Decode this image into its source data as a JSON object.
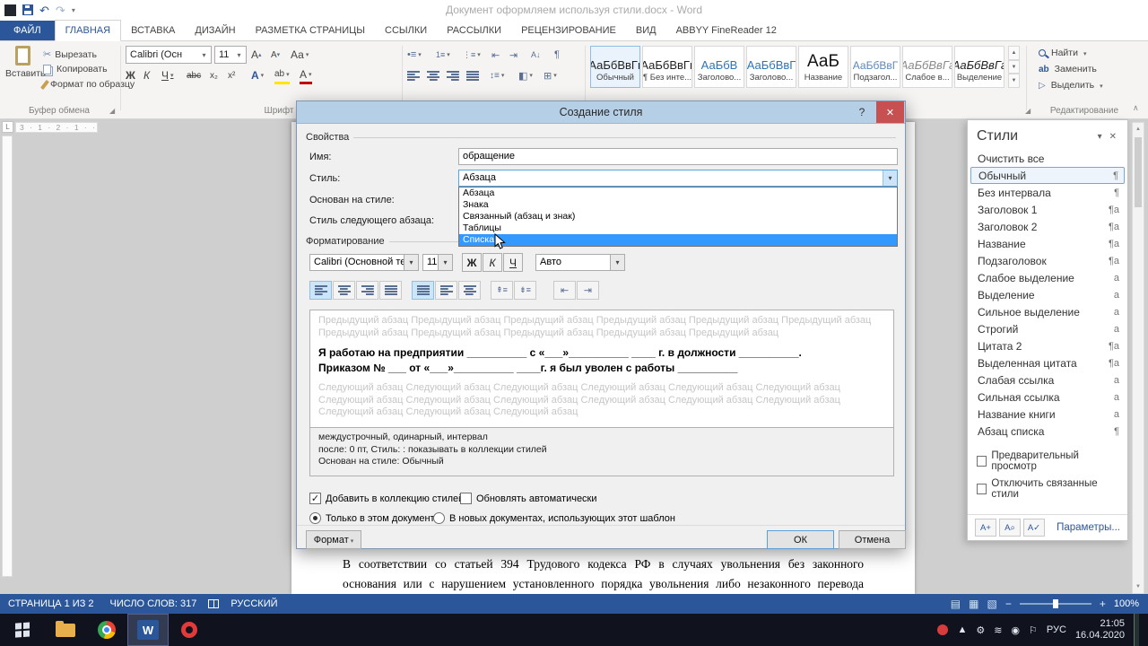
{
  "title_bar": {
    "title": "Документ оформляем используя стили.docx - Word"
  },
  "tabs": [
    "ФАЙЛ",
    "ГЛАВНАЯ",
    "ВСТАВКА",
    "ДИЗАЙН",
    "РАЗМЕТКА СТРАНИЦЫ",
    "ССЫЛКИ",
    "РАССЫЛКИ",
    "РЕЦЕНЗИРОВАНИЕ",
    "ВИД",
    "ABBYY FineReader 12"
  ],
  "ribbon": {
    "paste": "Вставить",
    "cut": "Вырезать",
    "copy": "Копировать",
    "format_painter": "Формат по образцу",
    "clipboard_label": "Буфер обмена",
    "font_name": "Calibri (Осн",
    "font_size": "11",
    "grow": "А",
    "shrink": "А",
    "case_btn": "Аа",
    "bold": "Ж",
    "italic": "К",
    "underline": "Ч",
    "strike": "abc",
    "sub": "x₂",
    "sup": "x²",
    "effects_letter": "А",
    "highlight_letters": "ab",
    "color_letter": "А",
    "font_label": "Шрифт",
    "gallery": [
      {
        "preview": "АаБбВвГг",
        "name": "Обычный"
      },
      {
        "preview": "АаБбВвГг",
        "name": "¶ Без инте..."
      },
      {
        "preview": "АаБбВ",
        "name": "Заголово..."
      },
      {
        "preview": "АаБбВвГ",
        "name": "Заголово..."
      },
      {
        "preview": "АаБ",
        "name": "Название"
      },
      {
        "preview": "АаБбВвГ",
        "name": "Подзагол..."
      },
      {
        "preview": "АаБбВвГг",
        "name": "Слабое в..."
      },
      {
        "preview": "АаБбВвГг",
        "name": "Выделение"
      }
    ],
    "find": "Найти",
    "replace": "Заменить",
    "select": "Выделить",
    "editing_label": "Редактирование"
  },
  "ruler": {
    "tab_selector": "L",
    "numbers": "3 · 1 · 2 · 1 · ·"
  },
  "dialog": {
    "title": "Создание стиля",
    "help": "?",
    "properties": "Свойства",
    "name_label": "Имя:",
    "name_value": "обращение",
    "type_label": "Стиль:",
    "type_value": "Абзаца",
    "based_label": "Основан на стиле:",
    "next_label": "Стиль следующего абзаца:",
    "options": [
      "Абзаца",
      "Знака",
      "Связанный (абзац и знак)",
      "Таблицы",
      "Списка"
    ],
    "formatting": "Форматирование",
    "font_name": "Calibri (Основной те",
    "font_size": "11",
    "bold": "Ж",
    "italic": "К",
    "underline": "Ч",
    "color": "Авто",
    "preview_prev": "Предыдущий абзац Предыдущий абзац Предыдущий абзац Предыдущий абзац Предыдущий абзац Предыдущий абзац Предыдущий абзац Предыдущий абзац Предыдущий абзац Предыдущий абзац Предыдущий абзац",
    "preview_line1": "Я работаю на предприятии __________ с «___»__________ ____ г. в должности __________.",
    "preview_line2": "Приказом № ___ от «___»__________ ____г. я был уволен с работы __________",
    "preview_next": "Следующий абзац Следующий абзац Следующий абзац Следующий абзац Следующий абзац Следующий абзац Следующий абзац Следующий абзац Следующий абзац Следующий абзац Следующий абзац Следующий абзац Следующий абзац Следующий абзац Следующий абзац",
    "desc1": "междустрочный,  одинарный, интервал",
    "desc2": "после: 0 пт, Стиль: : показывать в коллекции стилей",
    "desc3": "Основан на стиле: Обычный",
    "add_gallery": "Добавить в коллекцию стилей",
    "auto_update": "Обновлять автоматически",
    "only_doc": "Только в этом документе",
    "new_docs": "В новых документах, использующих этот шаблон",
    "format_btn": "Формат",
    "ok": "ОК",
    "cancel": "Отмена"
  },
  "styles_panel": {
    "title": "Стили",
    "clear_all": "Очистить все",
    "items": [
      {
        "label": "Обычный",
        "marker": "¶"
      },
      {
        "label": "Без интервала",
        "marker": "¶"
      },
      {
        "label": "Заголовок 1",
        "marker": "¶а"
      },
      {
        "label": "Заголовок 2",
        "marker": "¶а"
      },
      {
        "label": "Название",
        "marker": "¶а"
      },
      {
        "label": "Подзаголовок",
        "marker": "¶а"
      },
      {
        "label": "Слабое выделение",
        "marker": "а"
      },
      {
        "label": "Выделение",
        "marker": "а"
      },
      {
        "label": "Сильное выделение",
        "marker": "а"
      },
      {
        "label": "Строгий",
        "marker": "а"
      },
      {
        "label": "Цитата 2",
        "marker": "¶а"
      },
      {
        "label": "Выделенная цитата",
        "marker": "¶а"
      },
      {
        "label": "Слабая ссылка",
        "marker": "а"
      },
      {
        "label": "Сильная ссылка",
        "marker": "а"
      },
      {
        "label": "Название книги",
        "marker": "а"
      },
      {
        "label": "Абзац списка",
        "marker": "¶"
      }
    ],
    "preview_cb": "Предварительный просмотр",
    "linked_cb": "Отключить связанные стили",
    "options": "Параметры..."
  },
  "document": {
    "line1": "В соответствии со статьей 394  Трудового кодекса РФ в случаях увольнения без законного",
    "line2": "основания или с нарушением установленного порядка увольнения либо незаконного перевода"
  },
  "status_bar": {
    "page": "СТРАНИЦА 1 ИЗ 2",
    "words": "ЧИСЛО СЛОВ: 317",
    "language": "РУССКИЙ",
    "zoom": "100%"
  },
  "taskbar": {
    "word_letter": "W",
    "lang": "РУС",
    "time": "21:05",
    "date": "16.04.2020"
  }
}
